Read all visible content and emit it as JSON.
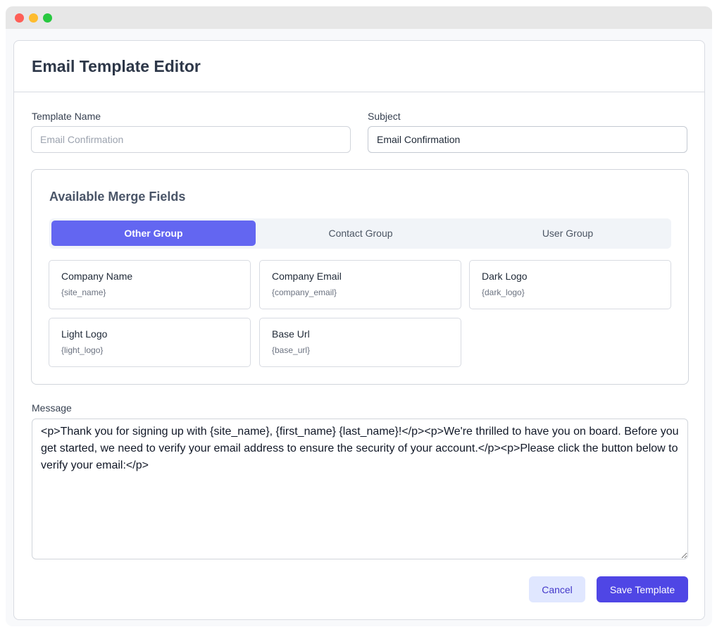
{
  "page": {
    "title": "Email Template Editor"
  },
  "form": {
    "template_name": {
      "label": "Template Name",
      "value": "",
      "placeholder": "Email Confirmation"
    },
    "subject": {
      "label": "Subject",
      "value": "Email Confirmation",
      "placeholder": ""
    },
    "message": {
      "label": "Message",
      "value": "<p>Thank you for signing up with {site_name}, {first_name} {last_name}!</p><p>We're thrilled to have you on board. Before you get started, we need to verify your email address to ensure the security of your account.</p><p>Please click the button below to verify your email:</p>"
    }
  },
  "merge_fields": {
    "title": "Available Merge Fields",
    "tabs": [
      {
        "label": "Other Group",
        "active": true
      },
      {
        "label": "Contact Group",
        "active": false
      },
      {
        "label": "User Group",
        "active": false
      }
    ],
    "fields": [
      {
        "label": "Company Name",
        "code": "{site_name}"
      },
      {
        "label": "Company Email",
        "code": "{company_email}"
      },
      {
        "label": "Dark Logo",
        "code": "{dark_logo}"
      },
      {
        "label": "Light Logo",
        "code": "{light_logo}"
      },
      {
        "label": "Base Url",
        "code": "{base_url}"
      }
    ]
  },
  "actions": {
    "cancel_label": "Cancel",
    "save_label": "Save Template"
  },
  "colors": {
    "accent": "#6366f1",
    "primary_button": "#4f46e5",
    "secondary_button": "#e0e7ff"
  }
}
